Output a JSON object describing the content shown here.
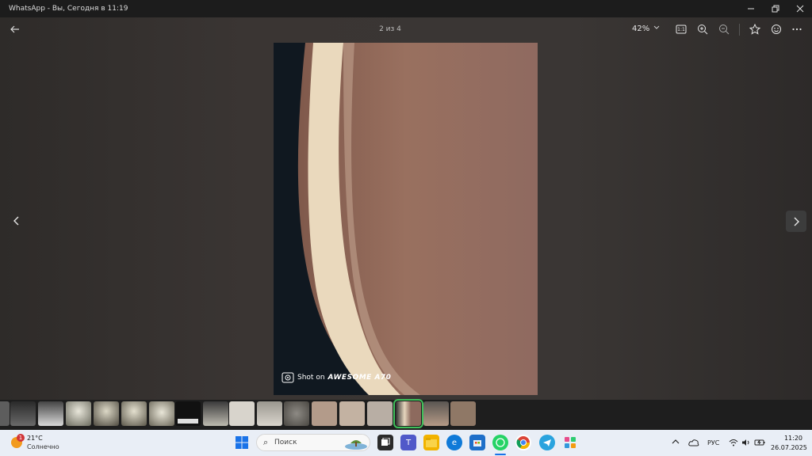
{
  "window": {
    "title": "WhatsApp - Вы, Сегодня в 11:19"
  },
  "toolbar": {
    "counter": "2 из 4",
    "zoom": "42%",
    "actual_size_label": "1:1"
  },
  "photo": {
    "watermark_prefix": "Shot on",
    "watermark_brand": "AWESOME A70"
  },
  "filmstrip": {
    "thumb_count": 17,
    "selected_index": 14
  },
  "taskbar": {
    "weather": {
      "badge": "1",
      "temp": "21°C",
      "condition": "Солнечно"
    },
    "search_placeholder": "Поиск",
    "language": "РУС",
    "time": "11:20",
    "date": "26.07.2025"
  },
  "colors": {
    "accent_selected": "#3fbf5a",
    "taskbar": "#e9eef6",
    "titlebar": "#1c1c1c"
  }
}
